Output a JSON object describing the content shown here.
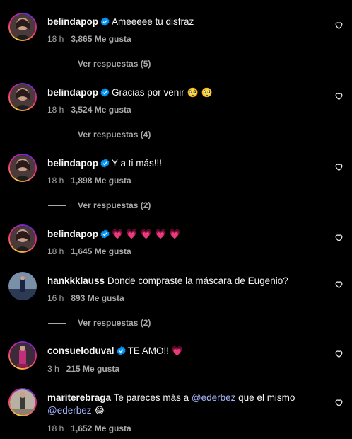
{
  "comments": [
    {
      "user": "belindapop",
      "verified": true,
      "text": "Ameeeee tu disfraz",
      "time": "18 h",
      "likes": "3,865 Me gusta",
      "replies": "Ver respuestas (5)"
    },
    {
      "user": "belindapop",
      "verified": true,
      "text": "Gracias por venir",
      "emoji": "🥺 🥺",
      "time": "18 h",
      "likes": "3,524 Me gusta",
      "replies": "Ver respuestas (4)"
    },
    {
      "user": "belindapop",
      "verified": true,
      "text": "Y a ti más!!!",
      "time": "18 h",
      "likes": "1,898 Me gusta",
      "replies": "Ver respuestas (2)"
    },
    {
      "user": "belindapop",
      "verified": true,
      "text": "",
      "emoji": "💗 💗 💗 💗 💗",
      "time": "18 h",
      "likes": "1,645 Me gusta"
    },
    {
      "user": "hankkklauss",
      "verified": false,
      "text": "Donde compraste la máscara de Eugenio?",
      "time": "16 h",
      "likes": "893 Me gusta",
      "replies": "Ver respuestas (2)"
    },
    {
      "user": "consueloduval",
      "verified": true,
      "text": "TE AMO!!",
      "emoji": "💗",
      "time": "3 h",
      "likes": "215 Me gusta"
    },
    {
      "user": "mariterebraga",
      "verified": false,
      "text_a": "Te pareces más a",
      "mention1": "@ederbez",
      "text_b": "que el mismo",
      "mention2": "@ederbez",
      "emoji": "😂",
      "time": "18 h",
      "likes": "1,652 Me gusta"
    }
  ],
  "colors": {
    "background": "#000000",
    "text": "#f5f5f5",
    "muted": "#a8a8a8",
    "verified": "#0095f6",
    "mention": "#a5b4fc"
  },
  "icons": {
    "verified": "verified-badge-icon",
    "like": "heart-outline-icon"
  }
}
